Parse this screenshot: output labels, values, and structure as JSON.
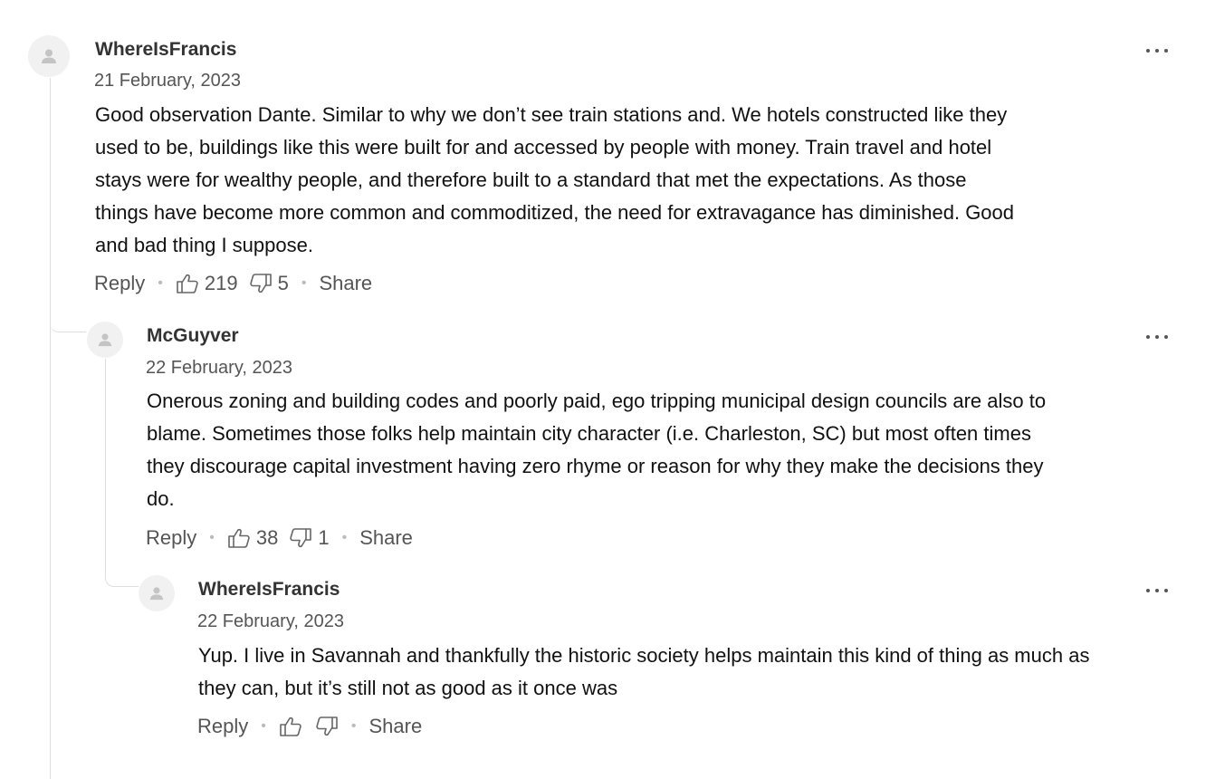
{
  "comments": [
    {
      "author": "WhereIsFrancis",
      "date": "21 February, 2023",
      "lines": [
        "Good observation Dante. Similar to why we don’t see train stations and. We hotels constructed like they",
        "used to be, buildings like this were built for and accessed by people with money. Train travel and hotel",
        "stays were for wealthy people, and therefore built to a standard that met the expectations. As those",
        "things have become more common and commoditized, the need for extravagance has diminished. Good",
        "and bad thing I suppose."
      ],
      "reply_label": "Reply",
      "likes": "219",
      "dislikes": "5",
      "share_label": "Share"
    },
    {
      "author": "McGuyver",
      "date": "22 February, 2023",
      "lines": [
        "Onerous zoning and building codes and poorly paid, ego tripping municipal design councils are also to",
        "blame. Sometimes those folks help maintain city character (i.e. Charleston, SC)  but most often times",
        "they discourage capital investment having zero rhyme or reason for why they make the decisions they",
        "do."
      ],
      "reply_label": "Reply",
      "likes": "38",
      "dislikes": "1",
      "share_label": "Share"
    },
    {
      "author": "WhereIsFrancis",
      "date": "22 February, 2023",
      "lines": [
        "Yup. I live in Savannah and thankfully the historic society helps maintain this kind of thing as much as",
        "they can, but it’s still not as good as it once was"
      ],
      "reply_label": "Reply",
      "likes": "",
      "dislikes": "",
      "share_label": "Share"
    }
  ],
  "icons": {
    "avatar": "user-silhouette-icon",
    "like": "thumbs-up-icon",
    "dislike": "thumbs-down-icon",
    "more": "more-horizontal-icon"
  },
  "colors": {
    "author": "#333333",
    "meta": "#555555",
    "thread_line": "#dedede",
    "avatar_bg": "#f1f1f1"
  }
}
